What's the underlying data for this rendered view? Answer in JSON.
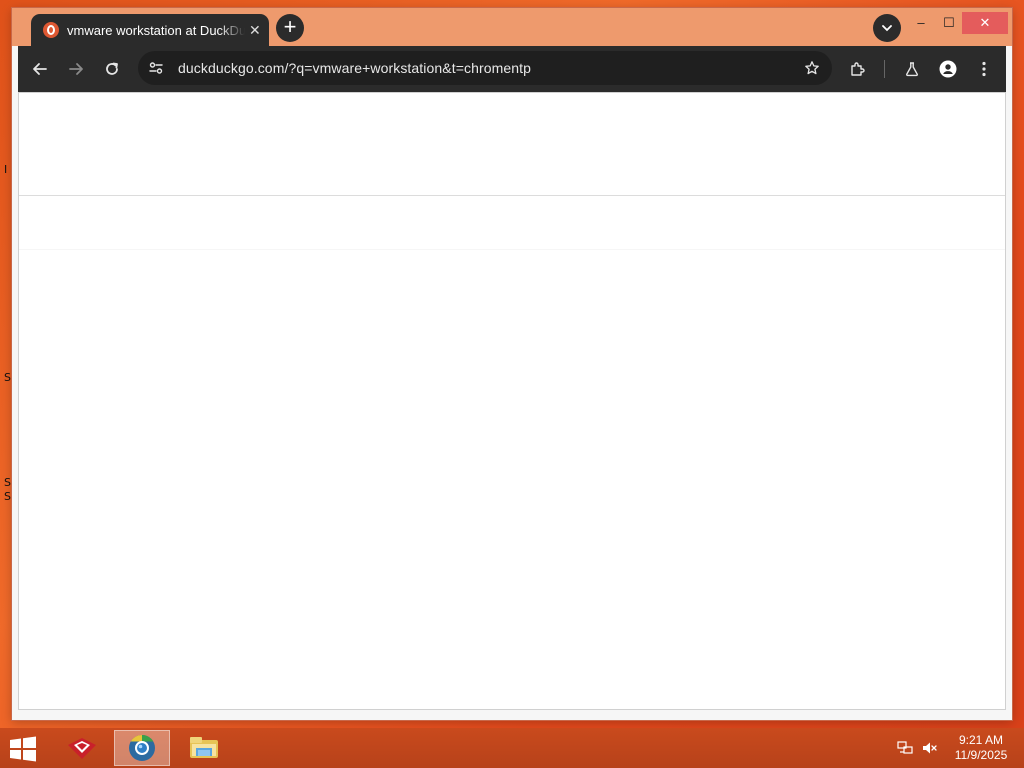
{
  "desktop": {
    "edge_glyphs": [
      "I",
      "S",
      "S",
      "S"
    ]
  },
  "browser": {
    "tab": {
      "title": "vmware workstation at DuckDuckGo",
      "favicon": "duckduckgo-icon"
    },
    "window_controls": {
      "minimize": "–",
      "maximize": "☐",
      "close": "✕"
    },
    "toolbar": {
      "url": "duckduckgo.com/?q=vmware+workstation&t=chromentp"
    }
  },
  "taskbar": {
    "clock_time": "9:21 AM",
    "clock_date": "11/9/2025",
    "apps": [
      "app-icon-red-logo",
      "chrome-icon",
      "file-explorer-icon"
    ],
    "active_app": "chrome-icon"
  },
  "colors": {
    "desktop_accent": "#e0521a",
    "titlebar": "#ee9a6d",
    "toolbar": "#2b2b2b",
    "close_button": "#e45c5c",
    "taskbar": "#c94a1d"
  }
}
